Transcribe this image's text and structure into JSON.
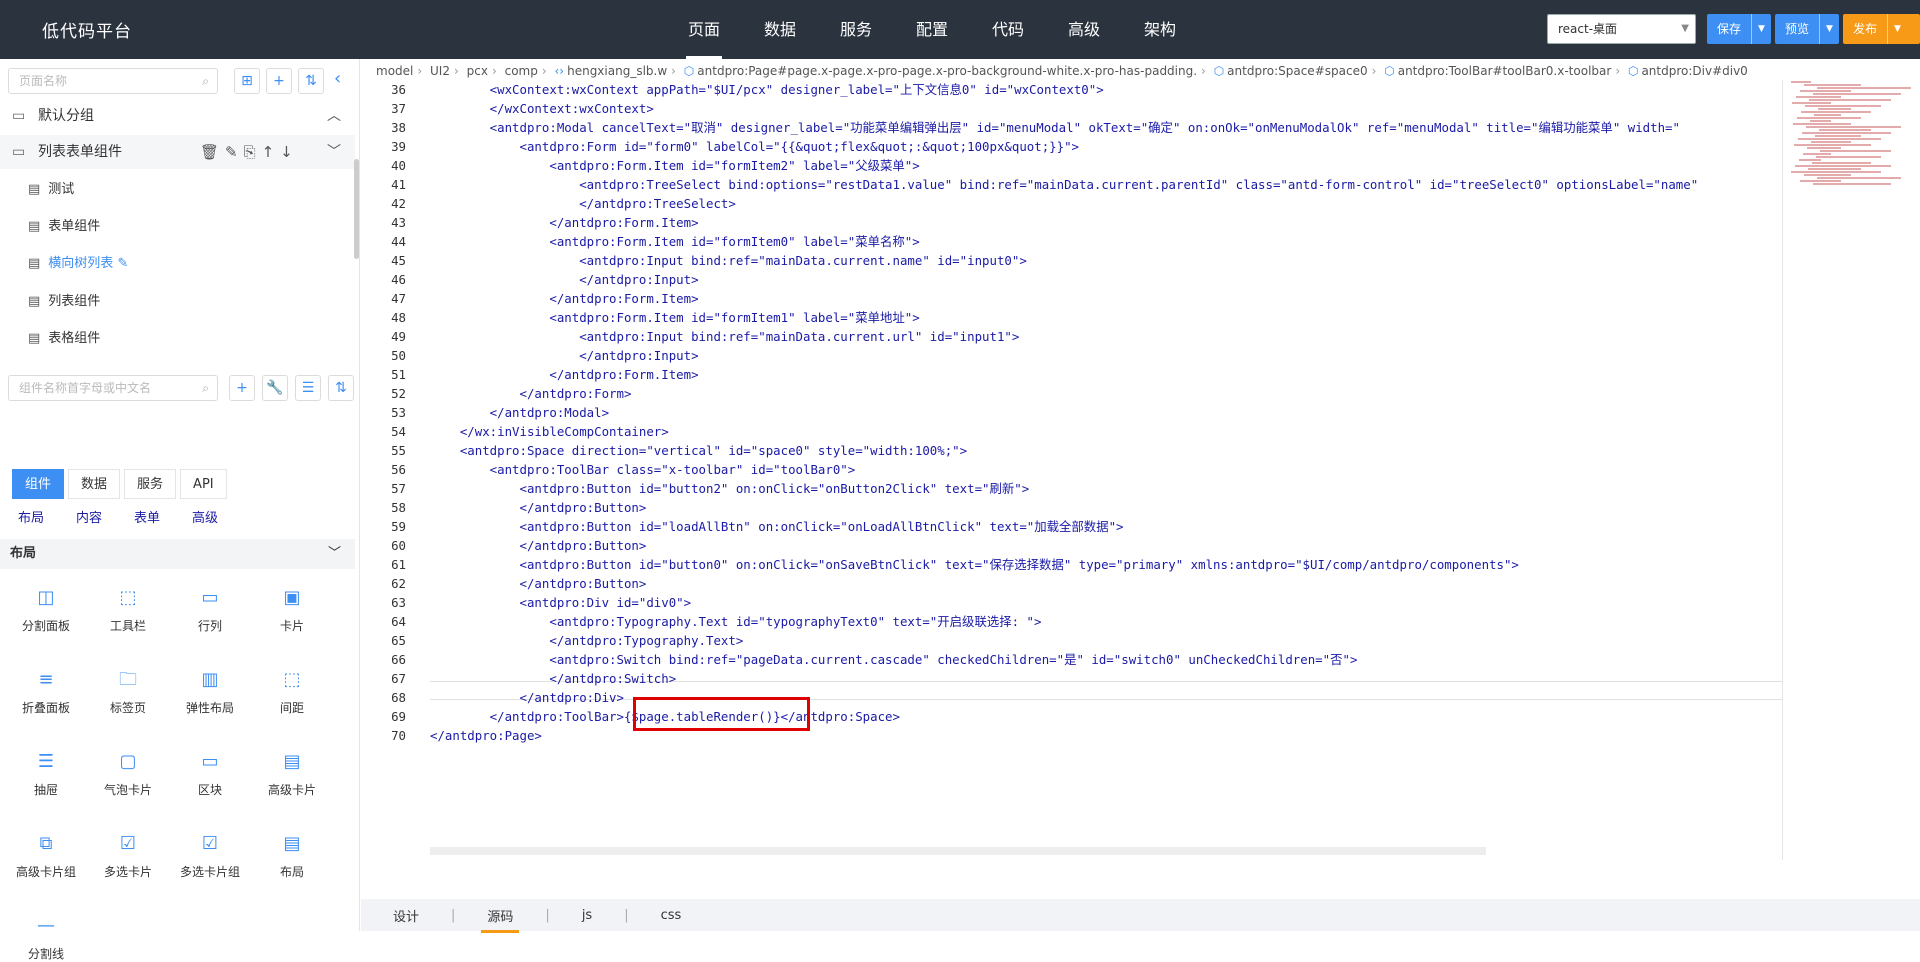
{
  "app": {
    "brand": "低代码平台"
  },
  "nav": [
    "页面",
    "数据",
    "服务",
    "配置",
    "代码",
    "高级",
    "架构"
  ],
  "env": {
    "value": "react-桌面"
  },
  "buttons": {
    "save": "保存",
    "preview": "预览",
    "publish": "发布"
  },
  "sidebar": {
    "page_search_placeholder": "页面名称",
    "groups": [
      {
        "label": "默认分组"
      },
      {
        "label": "列表表单组件"
      }
    ],
    "pages": [
      "测试",
      "表单组件",
      "横向树列表",
      "列表组件",
      "表格组件"
    ],
    "comp_search_placeholder": "组件名称首字母或中文名",
    "tabs": [
      "组件",
      "数据",
      "服务",
      "API"
    ],
    "subtabs": [
      "布局",
      "内容",
      "表单",
      "高级"
    ],
    "section": "布局",
    "components": [
      "分割面板",
      "工具栏",
      "行列",
      "卡片",
      "折叠面板",
      "标签页",
      "弹性布局",
      "间距",
      "抽屉",
      "气泡卡片",
      "区块",
      "高级卡片",
      "高级卡片组",
      "多选卡片",
      "多选卡片组",
      "布局",
      "分割线"
    ]
  },
  "breadcrumb": [
    "model",
    "UI2",
    "pcx",
    "comp",
    "hengxiang_slb.w",
    "antdpro:Page#page.x-page.x-pro-page.x-pro-background-white.x-pro-has-padding.",
    "antdpro:Space#space0",
    "antdpro:ToolBar#toolBar0.x-toolbar",
    "antdpro:Div#div0"
  ],
  "editor": {
    "line_numbers": [
      "36",
      "37",
      "38",
      "39",
      "40",
      "41",
      "42",
      "43",
      "44",
      "45",
      "46",
      "47",
      "48",
      "49",
      "50",
      "51",
      "52",
      "53",
      "54",
      "55",
      "56",
      "57",
      "58",
      "59",
      "60",
      "61",
      "62",
      "63",
      "64",
      "65",
      "66",
      "67",
      "68",
      "69",
      "70"
    ],
    "lines": [
      "        <wxContext:wxContext appPath=\"$UI/pcx\" designer_label=\"上下文信息0\" id=\"wxContext0\">",
      "        </wxContext:wxContext>",
      "        <antdpro:Modal cancelText=\"取消\" designer_label=\"功能菜单编辑弹出层\" id=\"menuModal\" okText=\"确定\" on:onOk=\"onMenuModalOk\" ref=\"menuModal\" title=\"编辑功能菜单\" width=\"",
      "            <antdpro:Form id=\"form0\" labelCol=\"{{&quot;flex&quot;:&quot;100px&quot;}}\">",
      "                <antdpro:Form.Item id=\"formItem2\" label=\"父级菜单\">",
      "                    <antdpro:TreeSelect bind:options=\"restData1.value\" bind:ref=\"mainData.current.parentId\" class=\"antd-form-control\" id=\"treeSelect0\" optionsLabel=\"name\"",
      "                    </antdpro:TreeSelect>",
      "                </antdpro:Form.Item>",
      "                <antdpro:Form.Item id=\"formItem0\" label=\"菜单名称\">",
      "                    <antdpro:Input bind:ref=\"mainData.current.name\" id=\"input0\">",
      "                    </antdpro:Input>",
      "                </antdpro:Form.Item>",
      "                <antdpro:Form.Item id=\"formItem1\" label=\"菜单地址\">",
      "                    <antdpro:Input bind:ref=\"mainData.current.url\" id=\"input1\">",
      "                    </antdpro:Input>",
      "                </antdpro:Form.Item>",
      "            </antdpro:Form>",
      "        </antdpro:Modal>",
      "    </wx:inVisibleCompContainer>",
      "    <antdpro:Space direction=\"vertical\" id=\"space0\" style=\"width:100%;\">",
      "        <antdpro:ToolBar class=\"x-toolbar\" id=\"toolBar0\">",
      "            <antdpro:Button id=\"button2\" on:onClick=\"onButton2Click\" text=\"刷新\">",
      "            </antdpro:Button>",
      "            <antdpro:Button id=\"loadAllBtn\" on:onClick=\"onLoadAllBtnClick\" text=\"加载全部数据\">",
      "            </antdpro:Button>",
      "            <antdpro:Button id=\"button0\" on:onClick=\"onSaveBtnClick\" text=\"保存选择数据\" type=\"primary\" xmlns:antdpro=\"$UI/comp/antdpro/components\">",
      "            </antdpro:Button>",
      "            <antdpro:Div id=\"div0\">",
      "                <antdpro:Typography.Text id=\"typographyText0\" text=\"开启级联选择: \">",
      "                </antdpro:Typography.Text>",
      "                <antdpro:Switch bind:ref=\"pageData.current.cascade\" checkedChildren=\"是\" id=\"switch0\" unCheckedChildren=\"否\">",
      "                </antdpro:Switch>",
      "            </antdpro:Div>",
      "        </antdpro:ToolBar>{$page.tableRender()}</antdpro:Space>",
      "</antdpro:Page>"
    ]
  },
  "bottom_tabs": [
    "设计",
    "源码",
    "js",
    "css"
  ]
}
